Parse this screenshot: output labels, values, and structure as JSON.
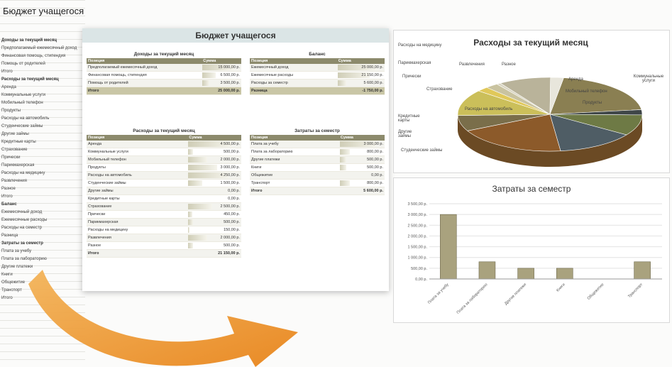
{
  "sheet": {
    "title": "Бюджет учащегося",
    "left_rows": [
      {
        "text": "Доходы за текущий месяц",
        "sec": true
      },
      {
        "text": "Предполагаемый ежемесячный доход"
      },
      {
        "text": "Финансовая помощь, стипендия"
      },
      {
        "text": "Помощь от родителей"
      },
      {
        "text": "Итого"
      },
      {
        "text": ""
      },
      {
        "text": "Расходы за текущий месяц",
        "sec": true
      },
      {
        "text": "Аренда"
      },
      {
        "text": "Коммунальные услуги"
      },
      {
        "text": "Мобильный телефон"
      },
      {
        "text": "Продукты"
      },
      {
        "text": "Расходы на автомобиль"
      },
      {
        "text": "Студенческие займы"
      },
      {
        "text": "Другие займы"
      },
      {
        "text": "Кредитные карты"
      },
      {
        "text": "Страхование"
      },
      {
        "text": "Прически"
      },
      {
        "text": "Парикмахерская"
      },
      {
        "text": "Расходы на медицину"
      },
      {
        "text": "Развлечения"
      },
      {
        "text": "Разное"
      },
      {
        "text": "Итого"
      },
      {
        "text": ""
      },
      {
        "text": "Баланс",
        "sec": true
      },
      {
        "text": "Ежемесячный доход"
      },
      {
        "text": "Ежемесячные расходы"
      },
      {
        "text": "Расходы на семестр"
      },
      {
        "text": "Разница"
      },
      {
        "text": ""
      },
      {
        "text": "Затраты за семестр",
        "sec": true
      },
      {
        "text": "Плата за учебу"
      },
      {
        "text": "Плата за лабораторию"
      },
      {
        "text": "Другие платежи"
      },
      {
        "text": "Книги"
      },
      {
        "text": "Общежитие"
      },
      {
        "text": "Транспорт"
      },
      {
        "text": "Итого"
      }
    ]
  },
  "workbook": {
    "title": "Бюджет учащегося",
    "col_item": "Позиция",
    "col_amount": "Сумма",
    "income": {
      "caption": "Доходы за текущий месяц",
      "rows": [
        {
          "item": "Предполагаемый ежемесячный доход",
          "amount": "15 000,00 р.",
          "level": 1.0
        },
        {
          "item": "Финансовая помощь, стипендия",
          "amount": "6 500,00 р.",
          "level": 0.43
        },
        {
          "item": "Помощь от родителей",
          "amount": "3 500,00 р.",
          "level": 0.23
        }
      ],
      "total_label": "Итого",
      "total": "25 000,00 р."
    },
    "balance": {
      "caption": "Баланс",
      "rows": [
        {
          "item": "Ежемесячный доход",
          "amount": "25 000,00 р.",
          "level": 1.0
        },
        {
          "item": "Ежемесячные расходы",
          "amount": "21 150,00 р.",
          "level": 0.85
        },
        {
          "item": "Расходы за семестр",
          "amount": "5 600,00 р.",
          "level": 0.22
        }
      ],
      "total_label": "Разница",
      "total": "-1 750,00 р."
    },
    "expenses": {
      "caption": "Расходы за текущий месяц",
      "rows": [
        {
          "item": "Аренда",
          "amount": "4 500,00 р.",
          "level": 1.0
        },
        {
          "item": "Коммунальные услуги",
          "amount": "500,00 р.",
          "level": 0.11
        },
        {
          "item": "Мобильный телефон",
          "amount": "2 000,00 р.",
          "level": 0.44
        },
        {
          "item": "Продукты",
          "amount": "3 000,00 р.",
          "level": 0.67
        },
        {
          "item": "Расходы на автомобиль",
          "amount": "4 250,00 р.",
          "level": 0.94
        },
        {
          "item": "Студенческие займы",
          "amount": "1 500,00 р.",
          "level": 0.33
        },
        {
          "item": "Другие займы",
          "amount": "0,00 р.",
          "level": 0
        },
        {
          "item": "Кредитные карты",
          "amount": "0,00 р.",
          "level": 0
        },
        {
          "item": "Страхование",
          "amount": "2 500,00 р.",
          "level": 0.56
        },
        {
          "item": "Прически",
          "amount": "450,00 р.",
          "level": 0.1
        },
        {
          "item": "Парикмахерская",
          "amount": "500,00 р.",
          "level": 0.11
        },
        {
          "item": "Расходы на медицину",
          "amount": "150,00 р.",
          "level": 0.03
        },
        {
          "item": "Развлечения",
          "amount": "2 000,00 р.",
          "level": 0.44
        },
        {
          "item": "Разное",
          "amount": "500,00 р.",
          "level": 0.11
        }
      ],
      "total_label": "Итого",
      "total": "21 150,00 р."
    },
    "semester": {
      "caption": "Затраты за семестр",
      "rows": [
        {
          "item": "Плата за учебу",
          "amount": "3 000,00 р.",
          "level": 1.0
        },
        {
          "item": "Плата за лабораторию",
          "amount": "800,00 р.",
          "level": 0.27
        },
        {
          "item": "Другие платежи",
          "amount": "500,00 р.",
          "level": 0.17
        },
        {
          "item": "Книги",
          "amount": "500,00 р.",
          "level": 0.17
        },
        {
          "item": "Общежитие",
          "amount": "0,00 р.",
          "level": 0
        },
        {
          "item": "Транспорт",
          "amount": "800,00 р.",
          "level": 0.27
        }
      ],
      "total_label": "Итого",
      "total": "5 600,00 р."
    }
  },
  "chart_data": [
    {
      "type": "pie",
      "title": "Расходы за текущий месяц",
      "categories": [
        "Аренда",
        "Коммунальные услуги",
        "Мобильный телефон",
        "Продукты",
        "Расходы на автомобиль",
        "Студенческие займы",
        "Другие займы",
        "Кредитные карты",
        "Страхование",
        "Прически",
        "Парикмахерская",
        "Расходы на медицину",
        "Развлечения",
        "Разное"
      ],
      "values": [
        4500,
        500,
        2000,
        3000,
        4250,
        1500,
        0,
        0,
        2500,
        450,
        500,
        150,
        2000,
        500
      ],
      "colors": [
        "#8a7f52",
        "#3f4648",
        "#6e7a45",
        "#4f5d65",
        "#8c5a2a",
        "#7a6e4a",
        "#777777",
        "#999999",
        "#cbbf5a",
        "#e0c85a",
        "#c9c3a0",
        "#d8d4c0",
        "#b9b39a",
        "#e8e6dc"
      ],
      "legend": "none"
    },
    {
      "type": "bar",
      "title": "Затраты за семестр",
      "categories": [
        "Плата за учебу",
        "Плата за лабораторию",
        "Другие платежи",
        "Книги",
        "Общежитие",
        "Транспорт"
      ],
      "values": [
        3000,
        800,
        500,
        500,
        0,
        800
      ],
      "ylim": [
        0,
        3500
      ],
      "yticks": [
        "0,00 р.",
        "500,00 р.",
        "1 000,00 р.",
        "1 500,00 р.",
        "2 000,00 р.",
        "2 500,00 р.",
        "3 000,00 р.",
        "3 500,00 р."
      ],
      "bar_color": "#a9a27e",
      "grid": true
    }
  ]
}
